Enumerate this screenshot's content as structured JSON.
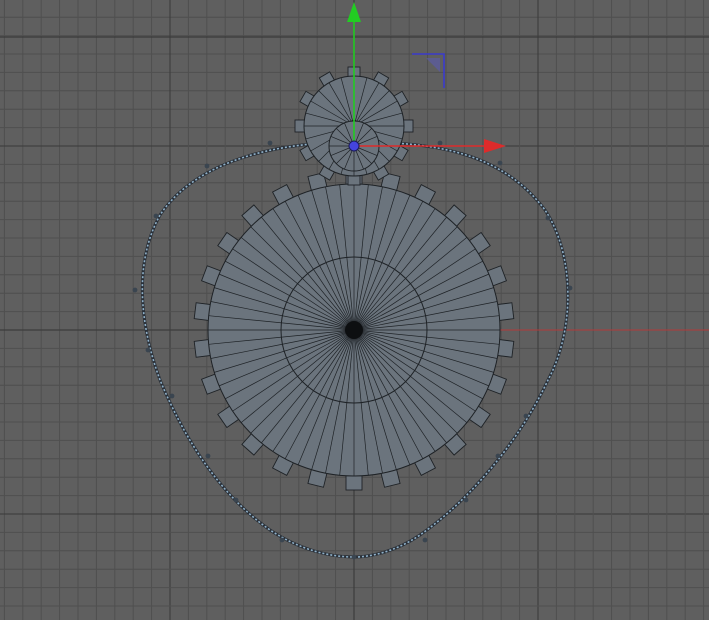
{
  "viewport": {
    "background": "#5f5f5f",
    "grid_color": "#4f4f4f",
    "grid_major_color": "#3a3a3a",
    "mesh_fill": "#6b747d",
    "mesh_stroke": "#1e2226",
    "path_color": "#8fb0c8",
    "gizmo": {
      "y_color": "#22cc22",
      "x_color": "#dd2b2b",
      "z_color": "#3a3acc",
      "origin_color": "#4444dd"
    },
    "large_gear": {
      "teeth": 26,
      "spokes": 64
    },
    "small_gear": {
      "teeth": 12,
      "spokes": 24
    },
    "tiny_gear": {
      "spokes": 16
    }
  }
}
